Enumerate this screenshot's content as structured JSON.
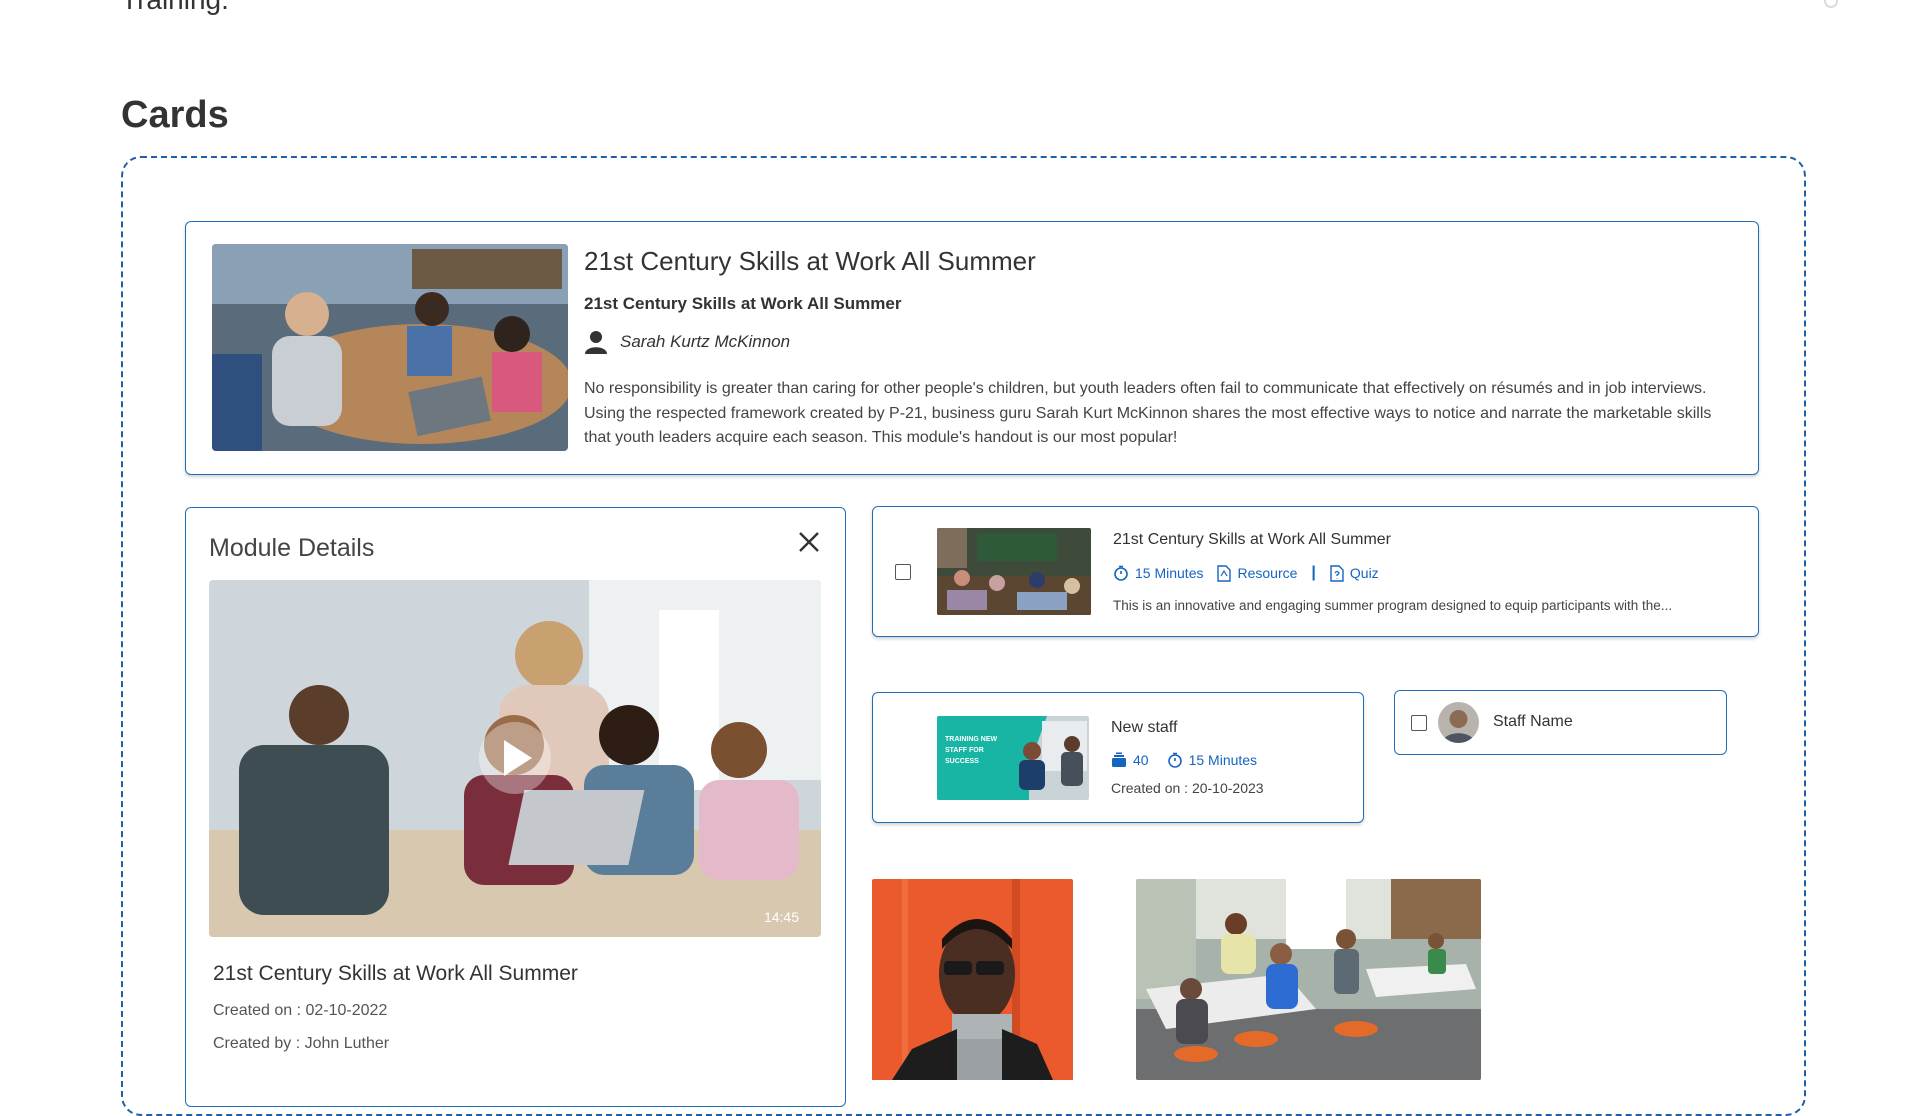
{
  "page": {
    "top_text": "Training.",
    "section_title": "Cards"
  },
  "featured_card": {
    "title": "21st Century Skills at Work All Summer",
    "subtitle": "21st Century Skills at Work All Summer",
    "author": "Sarah Kurtz McKinnon",
    "description": "No responsibility is greater than caring for other people's children, but youth leaders often fail to communicate that effectively on résumés and in job interviews. Using the respected framework created by P-21, business guru Sarah Kurt McKinnon shares the most effective ways to notice and narrate the marketable skills that youth leaders acquire each season. This module's handout is our most popular!"
  },
  "module_details": {
    "heading": "Module Details",
    "video_duration": "14:45",
    "title": "21st Century Skills at Work All Summer",
    "created_on": "Created on : 02-10-2022",
    "created_by": "Created by : John Luther"
  },
  "list_card": {
    "title": "21st Century Skills at Work All Summer",
    "duration": "15 Minutes",
    "resource": "Resource",
    "separator": "|",
    "quiz": "Quiz",
    "description": "This is an innovative and engaging summer program designed to equip participants with the..."
  },
  "staff_card": {
    "title": "New staff",
    "count": "40",
    "duration": "15 Minutes",
    "created_on": "Created on : 20-10-2023",
    "thumb_text": "TRAINING NEW STAFF FOR SUCCESS"
  },
  "staff_name_card": {
    "label": "Staff Name"
  },
  "colors": {
    "accent": "#1565c0",
    "border": "#1e6fb8",
    "teal": "#1fb8a8",
    "text": "#333333"
  }
}
